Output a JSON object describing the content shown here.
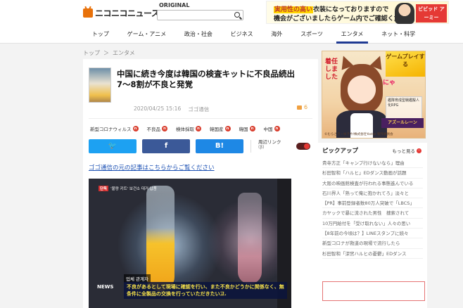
{
  "header": {
    "logo_text": "ニコニコニュース",
    "original_label": "ORIGINAL",
    "search_placeholder": "",
    "icons": [
      "niconico-tv-icon",
      "search-icon"
    ]
  },
  "top_ad": {
    "line1_prefix": "実用性の高い",
    "line1_rest": "衣装になっておりますので",
    "line2": "機会がございましたらゲーム内でご確認ください",
    "brand": "ビビッド アーミー"
  },
  "nav": {
    "items": [
      "トップ",
      "ゲーム・アニメ",
      "政治・社会",
      "ビジネス",
      "海外",
      "スポーツ",
      "エンタメ",
      "ネット・科学"
    ],
    "active_index": 6
  },
  "breadcrumb": [
    "トップ",
    "＞",
    "エンタメ"
  ],
  "article": {
    "title": "中国に続き今度は韓国の検査キットに不良品続出　7〜8割が不良と発覚",
    "date": "2020/04/25 15:16",
    "source": "ゴゴ通信",
    "comment_count": "6",
    "tags": [
      {
        "label": "新型コロナウィルス"
      },
      {
        "label": "不良品"
      },
      {
        "label": "検体採取"
      },
      {
        "label": "韓国産"
      },
      {
        "label": "韓国"
      },
      {
        "label": "中国"
      }
    ],
    "tag_badge": "n",
    "share": {
      "twitter": "🐦",
      "facebook": "f",
      "hatena": "B!"
    },
    "related_link_label": "周辺リンク",
    "related_link_sub": "(β)",
    "source_link": "ゴゴ通信の元の記事はこちらからご覧ください"
  },
  "video": {
    "badge_red": "단독",
    "badge_text": "'불량 키트' 보건소 대거 납품",
    "speaker": "업체 관계자",
    "caption": "不良があるとして現場に確認を行い、また不良かどうかに関係なく、無条件に全製品の交換を行っていただきたい고.",
    "news_mark": "NEWS"
  },
  "side_ad": {
    "banner": "ゲームプレイする",
    "red_text": "着任しました",
    "pink_text": "にゃ",
    "info": "艦隊育成型戦艦擬人化RPG",
    "logo": "アズールレーン",
    "copyright": "©むらさき・ゆきや/株式会社Yostar 製作委員会"
  },
  "pickup": {
    "heading": "ピックアップ",
    "more_label": "もっと見る",
    "more_icon": "chevron-right-icon",
    "items": [
      "貴寺方正「キャンプ行けないなら」理由",
      "杉田智和「ハルヒ」EDダンス動画が話題",
      "大阪の映画館検査が行われる事態進んでいる",
      "石川界人「熟って俺に抱かれてろ」淡々と",
      "【PR】事前登録者数80万人突破で「LBCS」",
      "カヤックで暴に流された男性　捜索されて",
      "10万円給付を「受け取れない」人々の思い",
      "【8年前の今頃は？】LINEスタンプに続々",
      "新型コロナが救道の現場で流行したら",
      "杉田智和「涼宮ハルヒの憂鬱」EDダンス"
    ]
  },
  "colors": {
    "accent_nav": "#1f3a93",
    "twitter": "#1da1f2",
    "facebook": "#3b5998",
    "hatena": "#1e88e5",
    "link": "#1a4fb3",
    "logo_orange": "#e8710a",
    "tag_badge": "#d94030"
  }
}
